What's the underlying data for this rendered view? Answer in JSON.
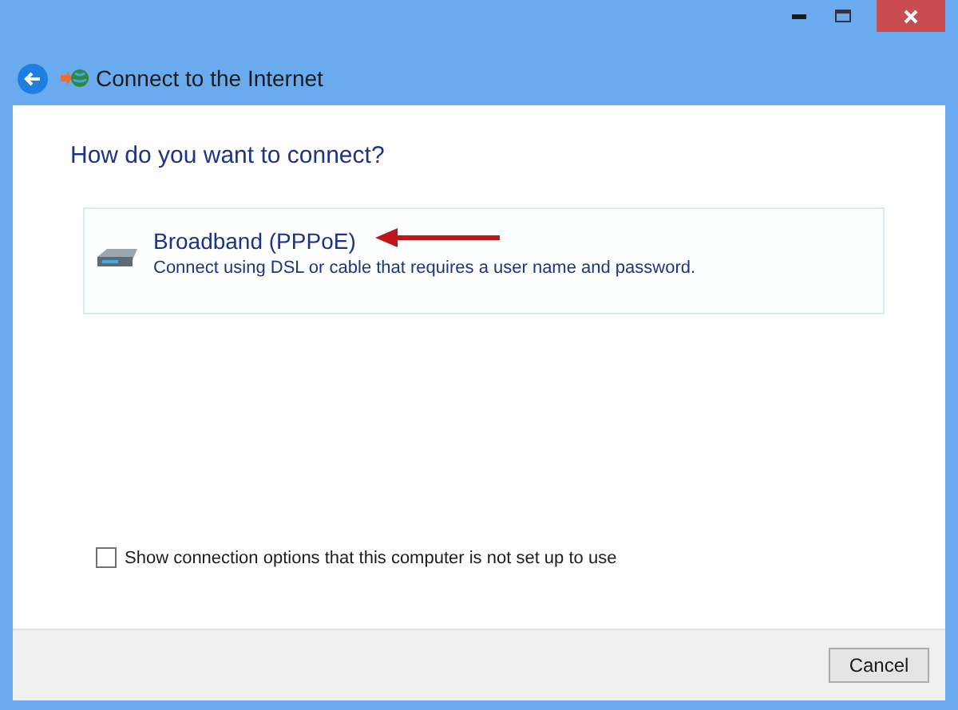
{
  "window": {
    "title": "Connect to the Internet"
  },
  "heading": "How do you want to connect?",
  "options": [
    {
      "title": "Broadband (PPPoE)",
      "description": "Connect using DSL or cable that requires a user name and password."
    }
  ],
  "show_all_option": {
    "label": "Show connection options that this computer is not set up to use",
    "checked": false
  },
  "buttons": [
    "Cancel"
  ]
}
